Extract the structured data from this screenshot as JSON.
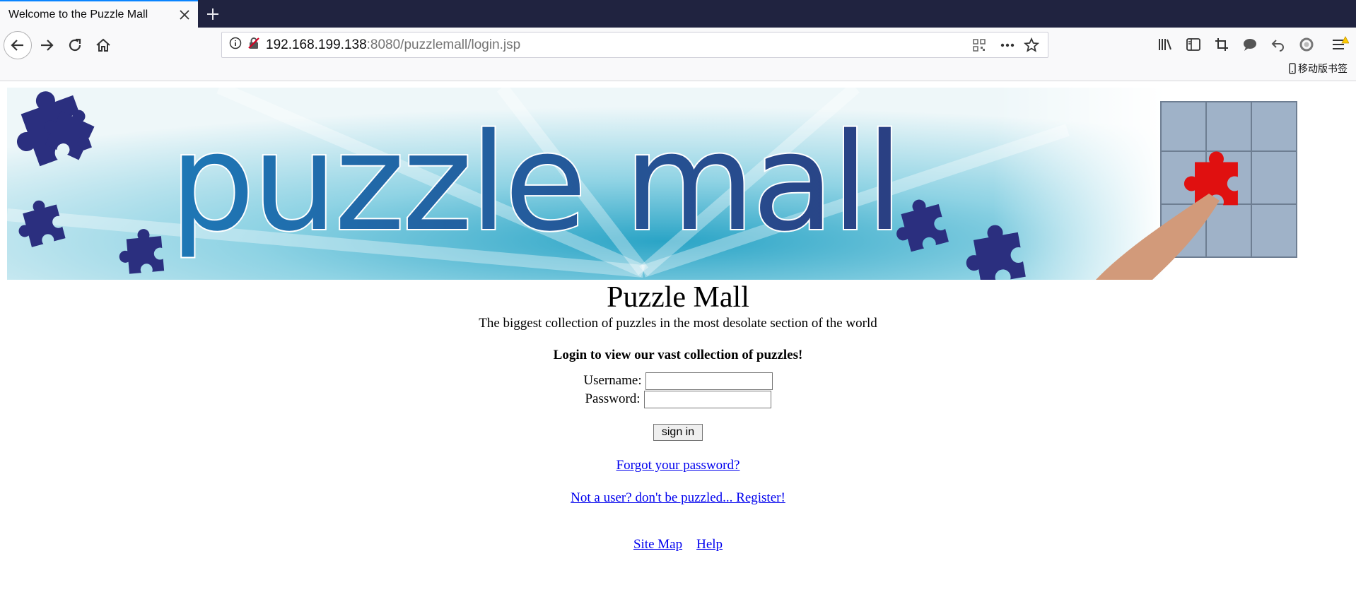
{
  "browser": {
    "tab_title": "Welcome to the Puzzle Mall",
    "url_host": "192.168.199.138",
    "url_rest": ":8080/puzzlemall/login.jsp",
    "bookmark_label": "移动版书签",
    "colors": {
      "tabbar": "#202340",
      "toolbar": "#f9f9fa",
      "accent": "#0a84ff",
      "warning": "#ffcc00"
    },
    "icons": [
      "back-icon",
      "forward-icon",
      "reload-icon",
      "home-icon",
      "info-icon",
      "insecure-lock-icon",
      "qr-code-icon",
      "more-icon",
      "star-icon",
      "library-icon",
      "sidebar-icon",
      "screenshot-icon",
      "chat-icon",
      "undo-icon",
      "record-icon",
      "menu-icon"
    ]
  },
  "banner": {
    "logo_text": "puzzle mall",
    "colors": {
      "sky": "#3fb6d3",
      "logo_text": "#1f6aa8",
      "puzzle_piece": "#2b2f7f",
      "highlight_piece": "#e01010"
    }
  },
  "page": {
    "title": "Puzzle Mall",
    "tagline": "The biggest collection of puzzles in the most desolate section of the world",
    "login_prompt": "Login to view our vast collection of puzzles!",
    "username_label": "Username:",
    "password_label": "Password:",
    "username_value": "",
    "password_value": "",
    "signin_label": "sign in",
    "forgot_link": "Forgot your password?",
    "register_link": "Not a user? don't be puzzled... Register!",
    "footer": {
      "sitemap": "Site Map",
      "help": "Help"
    },
    "colors": {
      "link": "#0000ee"
    }
  }
}
